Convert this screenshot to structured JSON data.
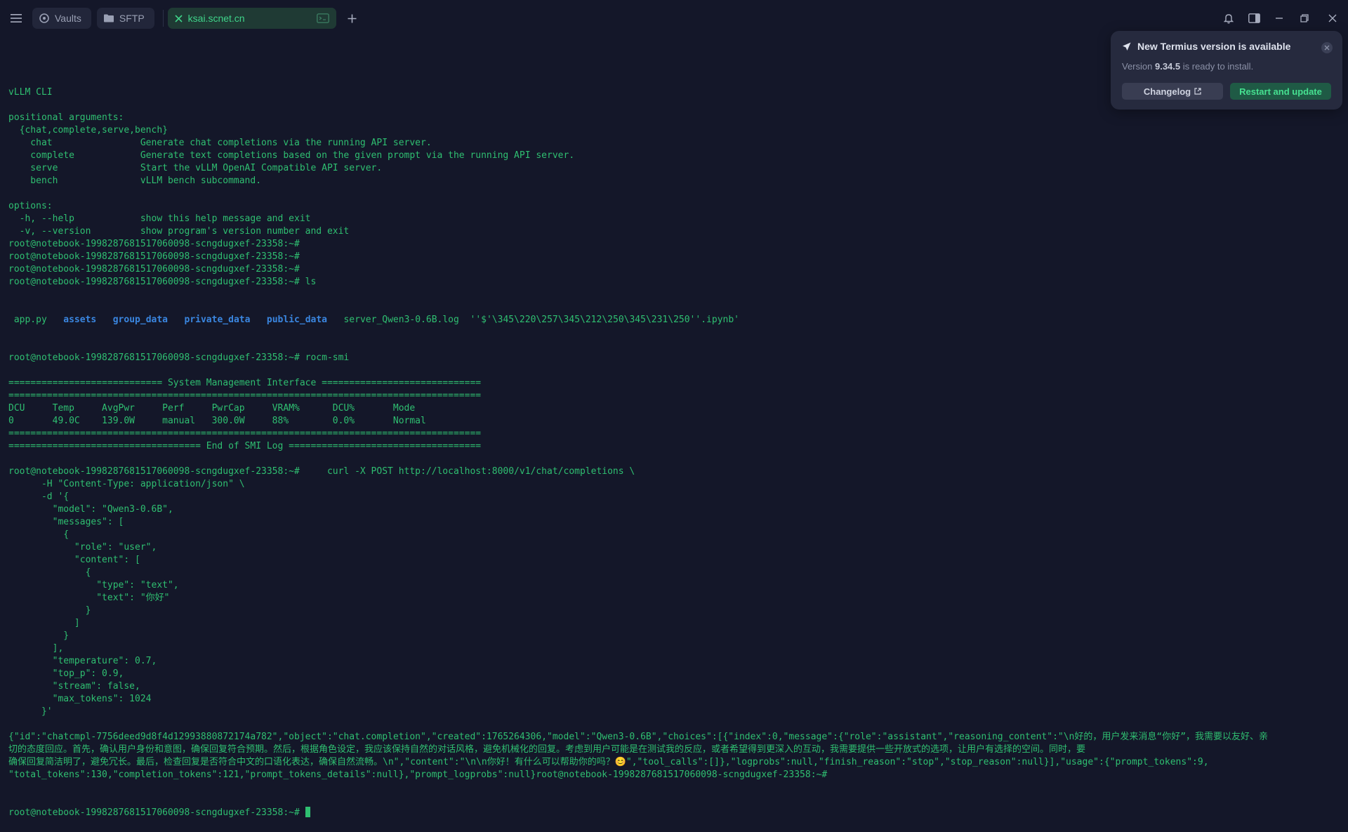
{
  "tabs": {
    "vaults": "Vaults",
    "sftp": "SFTP",
    "active": "ksai.scnet.cn"
  },
  "notification": {
    "title": "New Termius version is available",
    "text_prefix": "Version ",
    "version": "9.34.5",
    "text_suffix": " is ready to install.",
    "changelog": "Changelog",
    "restart": "Restart and update"
  },
  "terminal": {
    "lines": [
      "",
      "vLLM CLI",
      "",
      "positional arguments:",
      "  {chat,complete,serve,bench}",
      "    chat                Generate chat completions via the running API server.",
      "    complete            Generate text completions based on the given prompt via the running API server.",
      "    serve               Start the vLLM OpenAI Compatible API server.",
      "    bench               vLLM bench subcommand.",
      "",
      "options:",
      "  -h, --help            show this help message and exit",
      "  -v, --version         show program's version number and exit",
      "root@notebook-1998287681517060098-scngdugxef-23358:~#",
      "root@notebook-1998287681517060098-scngdugxef-23358:~#",
      "root@notebook-1998287681517060098-scngdugxef-23358:~#",
      "root@notebook-1998287681517060098-scngdugxef-23358:~# ls"
    ],
    "ls_output": {
      "app": " app.py   ",
      "dir1": "assets",
      "dir2": "group_data",
      "dir3": "private_data",
      "dir4": "public_data",
      "rest": "   server_Qwen3-0.6B.log  ''$'\\345\\220\\257\\345\\212\\250\\345\\231\\250''.ipynb'"
    },
    "lines2": [
      "root@notebook-1998287681517060098-scngdugxef-23358:~# rocm-smi",
      "",
      "============================ System Management Interface =============================",
      "======================================================================================",
      "DCU     Temp     AvgPwr     Perf     PwrCap     VRAM%      DCU%       Mode",
      "0       49.0C    139.0W     manual   300.0W     88%        0.0%       Normal",
      "======================================================================================",
      "=================================== End of SMI Log ===================================",
      "",
      "root@notebook-1998287681517060098-scngdugxef-23358:~#     curl -X POST http://localhost:8000/v1/chat/completions \\",
      "      -H \"Content-Type: application/json\" \\",
      "      -d '{",
      "        \"model\": \"Qwen3-0.6B\",",
      "        \"messages\": [",
      "          {",
      "            \"role\": \"user\",",
      "            \"content\": [",
      "              {",
      "                \"type\": \"text\",",
      "                \"text\": \"你好\"",
      "              }",
      "            ]",
      "          }",
      "        ],",
      "        \"temperature\": 0.7,",
      "        \"top_p\": 0.9,",
      "        \"stream\": false,",
      "        \"max_tokens\": 1024",
      "      }'",
      "",
      "{\"id\":\"chatcmpl-7756deed9d8f4d12993880872174a782\",\"object\":\"chat.completion\",\"created\":1765264306,\"model\":\"Qwen3-0.6B\",\"choices\":[{\"index\":0,\"message\":{\"role\":\"assistant\",\"reasoning_content\":\"\\n好的，用户发来消息“你好”，我需要以友好、亲",
      "切的态度回应。首先，确认用户身份和意图，确保回复符合预期。然后，根据角色设定，我应该保持自然的对话风格，避免机械化的回复。考虑到用户可能是在测试我的反应，或者希望得到更深入的互动，我需要提供一些开放式的选项，让用户有选择的空间。同时，要",
      "确保回复简洁明了，避免冗长。最后，检查回复是否符合中文的口语化表达，确保自然流畅。\\n\",\"content\":\"\\n\\n你好！有什么可以帮助你的吗？😊\",\"tool_calls\":[]},\"logprobs\":null,\"finish_reason\":\"stop\",\"stop_reason\":null}],\"usage\":{\"prompt_tokens\":9,",
      "\"total_tokens\":130,\"completion_tokens\":121,\"prompt_tokens_details\":null},\"prompt_logprobs\":null}root@notebook-1998287681517060098-scngdugxef-23358:~#"
    ],
    "prompt": "root@notebook-1998287681517060098-scngdugxef-23358:~# "
  }
}
